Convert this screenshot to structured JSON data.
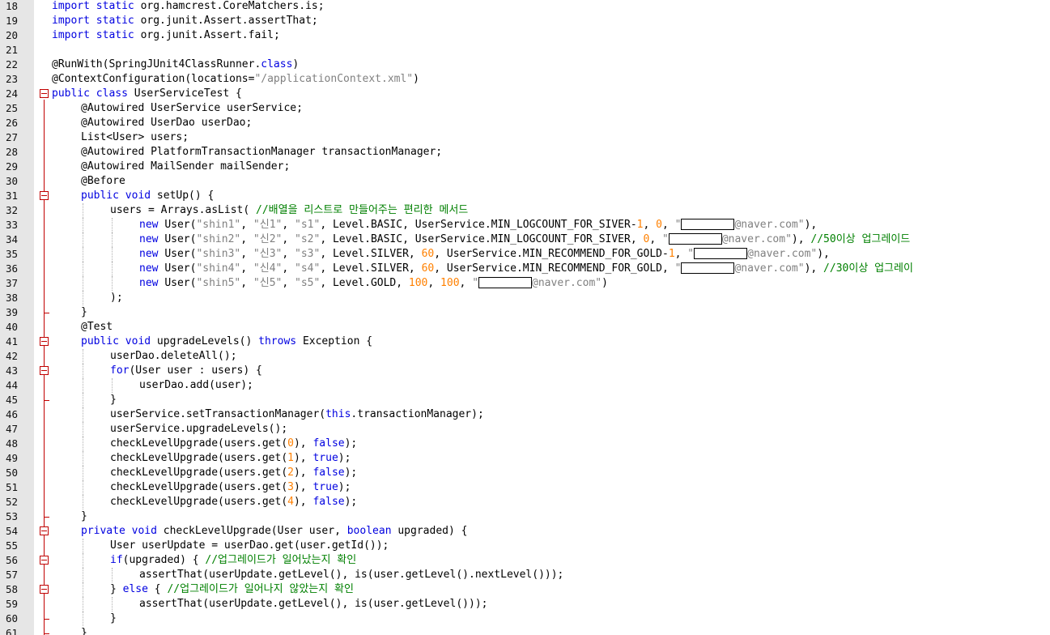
{
  "lines": [
    {
      "n": "18",
      "i": 0,
      "t": [
        {
          "c": "kw",
          "v": "import static "
        },
        {
          "v": "org.hamcrest.CoreMatchers.is;"
        }
      ]
    },
    {
      "n": "19",
      "i": 0,
      "t": [
        {
          "c": "kw",
          "v": "import static "
        },
        {
          "v": "org.junit.Assert.assertThat;"
        }
      ]
    },
    {
      "n": "20",
      "i": 0,
      "t": [
        {
          "c": "kw",
          "v": "import static "
        },
        {
          "v": "org.junit.Assert.fail;"
        }
      ]
    },
    {
      "n": "21",
      "i": 0,
      "t": []
    },
    {
      "n": "22",
      "i": 0,
      "t": [
        {
          "v": "@RunWith(SpringJUnit4ClassRunner."
        },
        {
          "c": "kw",
          "v": "class"
        },
        {
          "v": ")"
        }
      ]
    },
    {
      "n": "23",
      "i": 0,
      "t": [
        {
          "v": "@ContextConfiguration(locations="
        },
        {
          "c": "str",
          "v": "\"/applicationContext.xml\""
        },
        {
          "v": ")"
        }
      ]
    },
    {
      "n": "24",
      "i": 0,
      "f": "open",
      "t": [
        {
          "c": "kw",
          "v": "public class "
        },
        {
          "v": "UserServiceTest {"
        }
      ]
    },
    {
      "n": "25",
      "i": 1,
      "t": [
        {
          "v": "@Autowired UserService userService;"
        }
      ]
    },
    {
      "n": "26",
      "i": 1,
      "t": [
        {
          "v": "@Autowired UserDao userDao;"
        }
      ]
    },
    {
      "n": "27",
      "i": 1,
      "t": [
        {
          "v": "List<User> users;"
        }
      ]
    },
    {
      "n": "28",
      "i": 1,
      "t": [
        {
          "v": "@Autowired PlatformTransactionManager transactionManager;"
        }
      ]
    },
    {
      "n": "29",
      "i": 1,
      "t": [
        {
          "v": "@Autowired MailSender mailSender;"
        }
      ]
    },
    {
      "n": "30",
      "i": 1,
      "t": [
        {
          "v": "@Before"
        }
      ]
    },
    {
      "n": "31",
      "i": 1,
      "f": "open",
      "t": [
        {
          "c": "kw",
          "v": "public void "
        },
        {
          "v": "setUp() {"
        }
      ]
    },
    {
      "n": "32",
      "i": 2,
      "t": [
        {
          "v": "users = Arrays.asList( "
        },
        {
          "c": "cmt",
          "v": "//배열을 리스트로 만들어주는 편리한 메서드"
        }
      ]
    },
    {
      "n": "33",
      "i": 3,
      "t": [
        {
          "c": "kw",
          "v": "new "
        },
        {
          "v": "User("
        },
        {
          "c": "str",
          "v": "\"shin1\""
        },
        {
          "v": ", "
        },
        {
          "c": "str",
          "v": "\"신1\""
        },
        {
          "v": ", "
        },
        {
          "c": "str",
          "v": "\"s1\""
        },
        {
          "v": ", Level.BASIC, UserService.MIN_LOGCOUNT_FOR_SIVER-"
        },
        {
          "c": "num",
          "v": "1"
        },
        {
          "v": ", "
        },
        {
          "c": "num",
          "v": "0"
        },
        {
          "v": ", "
        },
        {
          "c": "str",
          "v": "\""
        },
        {
          "r": 1
        },
        {
          "c": "str",
          "v": "@naver.com\""
        },
        {
          "v": "),"
        }
      ]
    },
    {
      "n": "34",
      "i": 3,
      "t": [
        {
          "c": "kw",
          "v": "new "
        },
        {
          "v": "User("
        },
        {
          "c": "str",
          "v": "\"shin2\""
        },
        {
          "v": ", "
        },
        {
          "c": "str",
          "v": "\"신2\""
        },
        {
          "v": ", "
        },
        {
          "c": "str",
          "v": "\"s2\""
        },
        {
          "v": ", Level.BASIC, UserService.MIN_LOGCOUNT_FOR_SIVER, "
        },
        {
          "c": "num",
          "v": "0"
        },
        {
          "v": ", "
        },
        {
          "c": "str",
          "v": "\""
        },
        {
          "r": 1
        },
        {
          "c": "str",
          "v": "@naver.com\""
        },
        {
          "v": "), "
        },
        {
          "c": "cmt",
          "v": "//50이상 업그레이드"
        }
      ]
    },
    {
      "n": "35",
      "i": 3,
      "t": [
        {
          "c": "kw",
          "v": "new "
        },
        {
          "v": "User("
        },
        {
          "c": "str",
          "v": "\"shin3\""
        },
        {
          "v": ", "
        },
        {
          "c": "str",
          "v": "\"신3\""
        },
        {
          "v": ", "
        },
        {
          "c": "str",
          "v": "\"s3\""
        },
        {
          "v": ", Level.SILVER, "
        },
        {
          "c": "num",
          "v": "60"
        },
        {
          "v": ", UserService.MIN_RECOMMEND_FOR_GOLD-"
        },
        {
          "c": "num",
          "v": "1"
        },
        {
          "v": ", "
        },
        {
          "c": "str",
          "v": "\""
        },
        {
          "r": 1
        },
        {
          "c": "str",
          "v": "@naver.com\""
        },
        {
          "v": "),"
        }
      ]
    },
    {
      "n": "36",
      "i": 3,
      "t": [
        {
          "c": "kw",
          "v": "new "
        },
        {
          "v": "User("
        },
        {
          "c": "str",
          "v": "\"shin4\""
        },
        {
          "v": ", "
        },
        {
          "c": "str",
          "v": "\"신4\""
        },
        {
          "v": ", "
        },
        {
          "c": "str",
          "v": "\"s4\""
        },
        {
          "v": ", Level.SILVER, "
        },
        {
          "c": "num",
          "v": "60"
        },
        {
          "v": ", UserService.MIN_RECOMMEND_FOR_GOLD, "
        },
        {
          "c": "str",
          "v": "\""
        },
        {
          "r": 1
        },
        {
          "c": "str",
          "v": "@naver.com\""
        },
        {
          "v": "), "
        },
        {
          "c": "cmt",
          "v": "//30이상 업그레이"
        }
      ]
    },
    {
      "n": "37",
      "i": 3,
      "t": [
        {
          "c": "kw",
          "v": "new "
        },
        {
          "v": "User("
        },
        {
          "c": "str",
          "v": "\"shin5\""
        },
        {
          "v": ", "
        },
        {
          "c": "str",
          "v": "\"신5\""
        },
        {
          "v": ", "
        },
        {
          "c": "str",
          "v": "\"s5\""
        },
        {
          "v": ", Level.GOLD, "
        },
        {
          "c": "num",
          "v": "100"
        },
        {
          "v": ", "
        },
        {
          "c": "num",
          "v": "100"
        },
        {
          "v": ", "
        },
        {
          "c": "str",
          "v": "\""
        },
        {
          "r": 1
        },
        {
          "c": "str",
          "v": "@naver.com\""
        },
        {
          "v": ")"
        }
      ]
    },
    {
      "n": "38",
      "i": 2,
      "t": [
        {
          "v": ");"
        }
      ]
    },
    {
      "n": "39",
      "i": 1,
      "f": "close",
      "t": [
        {
          "v": "}"
        }
      ]
    },
    {
      "n": "40",
      "i": 1,
      "t": [
        {
          "v": "@Test"
        }
      ]
    },
    {
      "n": "41",
      "i": 1,
      "f": "open",
      "t": [
        {
          "c": "kw",
          "v": "public void "
        },
        {
          "v": "upgradeLevels() "
        },
        {
          "c": "kw",
          "v": "throws "
        },
        {
          "v": "Exception {"
        }
      ]
    },
    {
      "n": "42",
      "i": 2,
      "t": [
        {
          "v": "userDao.deleteAll();"
        }
      ]
    },
    {
      "n": "43",
      "i": 2,
      "f": "open",
      "t": [
        {
          "c": "kw",
          "v": "for"
        },
        {
          "v": "(User user : users) {"
        }
      ]
    },
    {
      "n": "44",
      "i": 3,
      "t": [
        {
          "v": "userDao.add(user);"
        }
      ]
    },
    {
      "n": "45",
      "i": 2,
      "f": "close",
      "t": [
        {
          "v": "}"
        }
      ]
    },
    {
      "n": "46",
      "i": 2,
      "t": [
        {
          "v": "userService.setTransactionManager("
        },
        {
          "c": "kw",
          "v": "this"
        },
        {
          "v": ".transactionManager);"
        }
      ]
    },
    {
      "n": "47",
      "i": 2,
      "t": [
        {
          "v": "userService.upgradeLevels();"
        }
      ]
    },
    {
      "n": "48",
      "i": 2,
      "t": [
        {
          "v": "checkLevelUpgrade(users.get("
        },
        {
          "c": "num",
          "v": "0"
        },
        {
          "v": "), "
        },
        {
          "c": "kw",
          "v": "false"
        },
        {
          "v": ");"
        }
      ]
    },
    {
      "n": "49",
      "i": 2,
      "t": [
        {
          "v": "checkLevelUpgrade(users.get("
        },
        {
          "c": "num",
          "v": "1"
        },
        {
          "v": "), "
        },
        {
          "c": "kw",
          "v": "true"
        },
        {
          "v": ");"
        }
      ]
    },
    {
      "n": "50",
      "i": 2,
      "t": [
        {
          "v": "checkLevelUpgrade(users.get("
        },
        {
          "c": "num",
          "v": "2"
        },
        {
          "v": "), "
        },
        {
          "c": "kw",
          "v": "false"
        },
        {
          "v": ");"
        }
      ]
    },
    {
      "n": "51",
      "i": 2,
      "t": [
        {
          "v": "checkLevelUpgrade(users.get("
        },
        {
          "c": "num",
          "v": "3"
        },
        {
          "v": "), "
        },
        {
          "c": "kw",
          "v": "true"
        },
        {
          "v": ");"
        }
      ]
    },
    {
      "n": "52",
      "i": 2,
      "t": [
        {
          "v": "checkLevelUpgrade(users.get("
        },
        {
          "c": "num",
          "v": "4"
        },
        {
          "v": "), "
        },
        {
          "c": "kw",
          "v": "false"
        },
        {
          "v": ");"
        }
      ]
    },
    {
      "n": "53",
      "i": 1,
      "f": "close",
      "t": [
        {
          "v": "}"
        }
      ]
    },
    {
      "n": "54",
      "i": 1,
      "f": "open",
      "t": [
        {
          "c": "kw",
          "v": "private void "
        },
        {
          "v": "checkLevelUpgrade(User user, "
        },
        {
          "c": "kw",
          "v": "boolean "
        },
        {
          "v": "upgraded) {"
        }
      ]
    },
    {
      "n": "55",
      "i": 2,
      "t": [
        {
          "v": "User userUpdate = userDao.get(user.getId());"
        }
      ]
    },
    {
      "n": "56",
      "i": 2,
      "f": "open",
      "t": [
        {
          "c": "kw",
          "v": "if"
        },
        {
          "v": "(upgraded) { "
        },
        {
          "c": "cmt",
          "v": "//업그레이드가 일어났는지 확인"
        }
      ]
    },
    {
      "n": "57",
      "i": 3,
      "t": [
        {
          "v": "assertThat(userUpdate.getLevel(), is(user.getLevel().nextLevel()));"
        }
      ]
    },
    {
      "n": "58",
      "i": 2,
      "f": "mid",
      "t": [
        {
          "v": "} "
        },
        {
          "c": "kw",
          "v": "else "
        },
        {
          "v": "{ "
        },
        {
          "c": "cmt",
          "v": "//업그레이드가 일어나지 않았는지 확인"
        }
      ]
    },
    {
      "n": "59",
      "i": 3,
      "t": [
        {
          "v": "assertThat(userUpdate.getLevel(), is(user.getLevel()));"
        }
      ]
    },
    {
      "n": "60",
      "i": 2,
      "f": "close",
      "t": [
        {
          "v": "}"
        }
      ]
    },
    {
      "n": "61",
      "i": 1,
      "f": "close",
      "t": [
        {
          "v": "}"
        }
      ]
    }
  ],
  "colors": {
    "keyword": "#0000e0",
    "number": "#ff8000",
    "string": "#808080",
    "comment": "#008000",
    "gutter": "#e6e6e6",
    "fold": "#c00000"
  }
}
